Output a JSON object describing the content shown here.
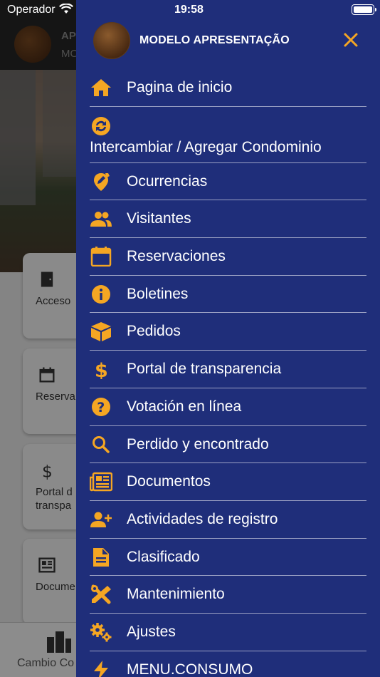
{
  "status_bar": {
    "carrier": "Operador",
    "time": "19:58"
  },
  "background": {
    "header_title": "AP",
    "header_sub": "MO",
    "cards": [
      {
        "label": "Acceso",
        "icon": "door-icon"
      },
      {
        "label": "Reserva",
        "icon": "calendar-icon"
      },
      {
        "label": "Portal d\ntranspa",
        "icon": "dollar-icon"
      },
      {
        "label": "Docume",
        "icon": "newspaper-icon"
      }
    ],
    "bottom_tab": {
      "label": "Cambio Co",
      "icon": "buildings-icon"
    }
  },
  "drawer": {
    "title": "MODELO APRESENTAÇÃO",
    "accent_color": "#f5a623",
    "background_color": "#1f2e7a",
    "items": [
      {
        "label": "Pagina de inicio",
        "icon": "home-icon"
      },
      {
        "label": "Intercambiar / Agregar Condominio",
        "icon": "swap-icon"
      },
      {
        "label": "Ocurrencias",
        "icon": "edit-tag-icon"
      },
      {
        "label": "Visitantes",
        "icon": "people-icon"
      },
      {
        "label": "Reservaciones",
        "icon": "calendar-icon"
      },
      {
        "label": "Boletines",
        "icon": "info-icon"
      },
      {
        "label": "Pedidos",
        "icon": "package-icon"
      },
      {
        "label": "Portal de transparencia",
        "icon": "dollar-icon"
      },
      {
        "label": "Votación en línea",
        "icon": "help-icon"
      },
      {
        "label": "Perdido y encontrado",
        "icon": "search-icon"
      },
      {
        "label": "Documentos",
        "icon": "newspaper-icon"
      },
      {
        "label": "Actividades de registro",
        "icon": "add-person-icon"
      },
      {
        "label": "Clasificado",
        "icon": "document-icon"
      },
      {
        "label": "Mantenimiento",
        "icon": "tools-icon"
      },
      {
        "label": "Ajustes",
        "icon": "gears-icon"
      },
      {
        "label": "MENU.CONSUMO",
        "icon": "bolt-icon"
      }
    ]
  }
}
